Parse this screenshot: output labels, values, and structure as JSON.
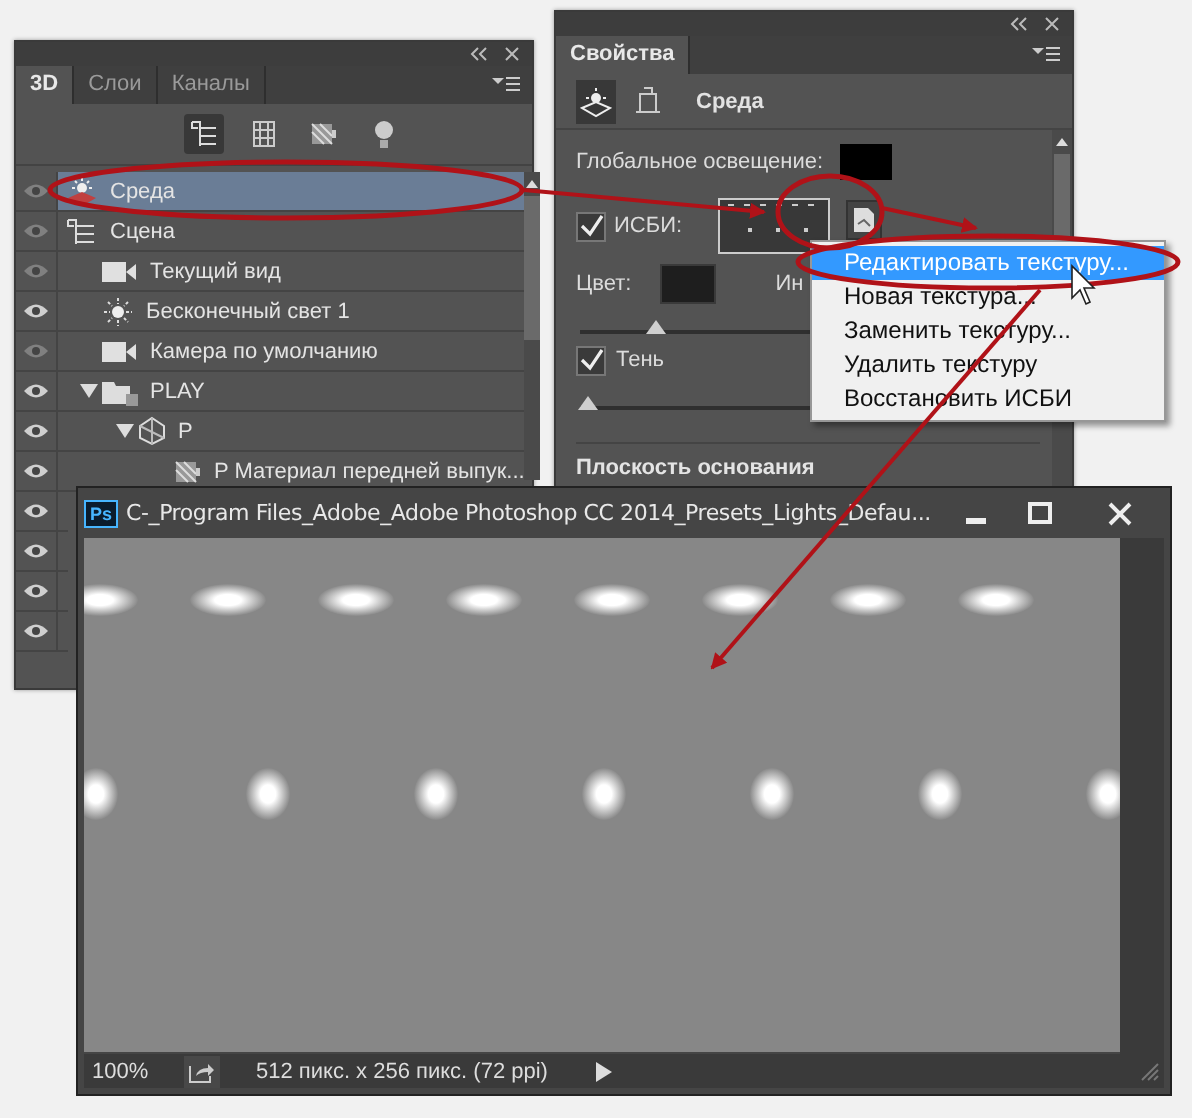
{
  "layers_panel": {
    "tabs": [
      {
        "label": "3D",
        "selected": true
      },
      {
        "label": "Слои",
        "selected": false
      },
      {
        "label": "Каналы",
        "selected": false
      }
    ],
    "tools": [
      {
        "kind": "scene",
        "selected": true
      },
      {
        "kind": "mesh",
        "selected": false
      },
      {
        "kind": "material",
        "selected": false
      },
      {
        "kind": "light",
        "selected": false
      }
    ],
    "layers": [
      {
        "label": "Среда",
        "kind": "environment",
        "visible": false,
        "selected": true
      },
      {
        "label": "Сцена",
        "kind": "scene",
        "visible": false,
        "selected": false,
        "children": [
          {
            "label": "Текущий вид",
            "kind": "camera",
            "visible": false,
            "selected": false
          },
          {
            "label": "Бесконечный свет 1",
            "kind": "light",
            "visible": true,
            "selected": false
          },
          {
            "label": "Камера по умолчанию",
            "kind": "camera",
            "visible": false,
            "selected": false
          },
          {
            "label": "PLAY",
            "kind": "folder",
            "visible": true,
            "selected": false,
            "expanded": true,
            "children": [
              {
                "label": "P",
                "kind": "mesh",
                "visible": true,
                "selected": false,
                "expanded": true,
                "children": [
                  {
                    "label": "P Материал передней выпук...",
                    "kind": "material",
                    "visible": true,
                    "selected": false
                  }
                ]
              }
            ]
          }
        ]
      },
      {
        "visible": true,
        "selected": false
      },
      {
        "visible": true,
        "selected": false
      },
      {
        "visible": true,
        "selected": false
      },
      {
        "visible": true,
        "selected": false
      }
    ]
  },
  "properties_panel": {
    "tab": "Свойства",
    "mode": "Среда",
    "global_light_label": "Глобальное освещение:",
    "ibl": {
      "label": "ИСБИ:",
      "checked": true
    },
    "color_label": "Цвет:",
    "label_cut": "Ин",
    "intensity_slider": {
      "level": 0.15
    },
    "shadow": {
      "label": "Тень",
      "checked": true
    },
    "shadow_slider": {
      "level": 0.0
    },
    "section": "Плоскость основания"
  },
  "context_menu": {
    "items": [
      {
        "label": "Редактировать текстуру...",
        "selected": true
      },
      {
        "label": "Новая текстура...",
        "selected": false
      },
      {
        "label": "Заменить текстуру...",
        "selected": false
      },
      {
        "label": "Удалить текстуру",
        "selected": false
      },
      {
        "label": "Восстановить ИСБИ",
        "selected": false
      }
    ]
  },
  "image_window": {
    "app_badge": "Ps",
    "title": "C-_Program Files_Adobe_Adobe Photoshop CC 2014_Presets_Lights_Defau...",
    "zoom": "100%",
    "doc_info": "512 пикс. x 256 пикс. (72 ppi)"
  }
}
